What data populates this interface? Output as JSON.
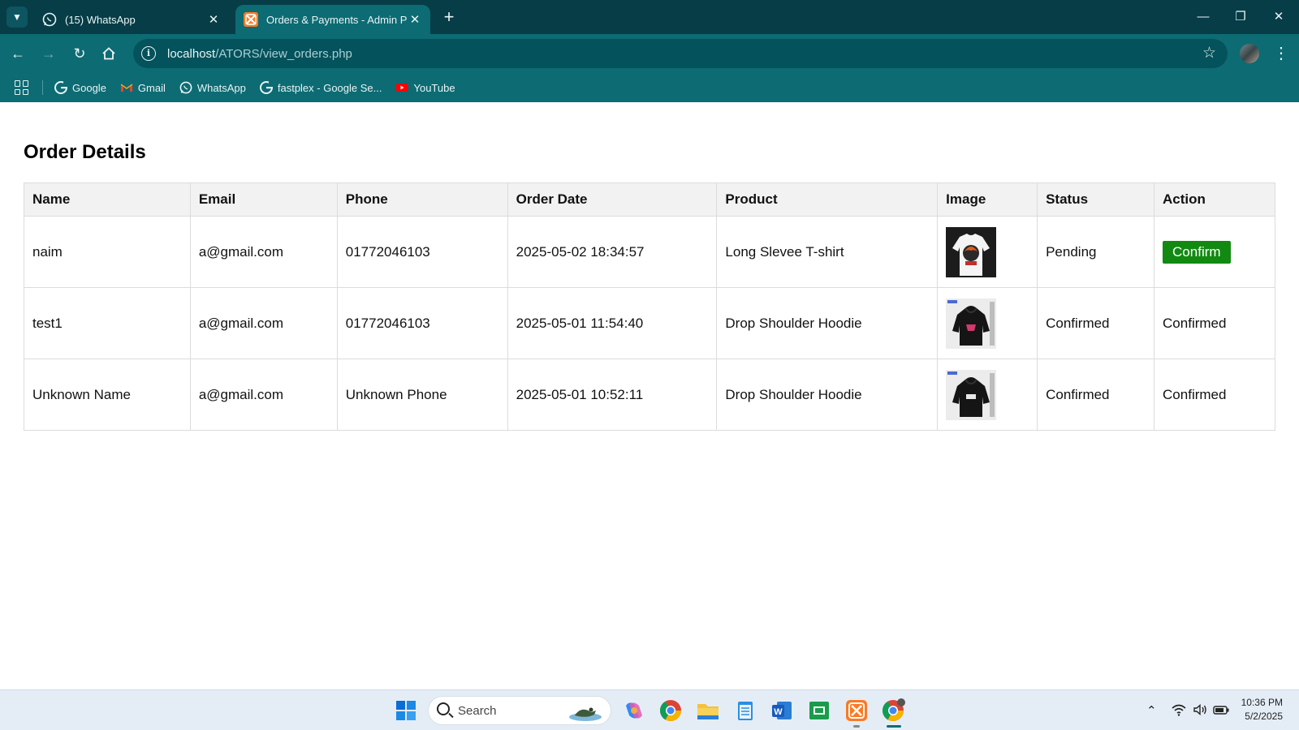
{
  "browser": {
    "tabs": [
      {
        "title": "(15) WhatsApp",
        "active": false,
        "favicon": "whatsapp-icon"
      },
      {
        "title": "Orders & Payments - Admin Pa",
        "active": true,
        "favicon": "xampp-icon"
      }
    ],
    "close_glyph": "✕",
    "new_tab_glyph": "+",
    "address": {
      "host": "localhost",
      "path": "/ATORS/view_orders.php"
    },
    "bookmarks": [
      {
        "label": "Google",
        "icon": "google-icon"
      },
      {
        "label": "Gmail",
        "icon": "gmail-icon"
      },
      {
        "label": "WhatsApp",
        "icon": "whatsapp-icon"
      },
      {
        "label": "fastplex - Google Se...",
        "icon": "google-icon"
      },
      {
        "label": "YouTube",
        "icon": "youtube-icon"
      }
    ],
    "accent_color": "#0d6b73"
  },
  "page": {
    "title": "Order Details",
    "table": {
      "headers": [
        "Name",
        "Email",
        "Phone",
        "Order Date",
        "Product",
        "Image",
        "Status",
        "Action"
      ],
      "rows": [
        {
          "name": "naim",
          "email": "a@gmail.com",
          "phone": "01772046103",
          "date": "2025-05-02 18:34:57",
          "product": "Long Slevee T-shirt",
          "image": "white-tshirt-thumbnail",
          "status": "Pending",
          "action": "Confirm",
          "action_is_button": true
        },
        {
          "name": "test1",
          "email": "a@gmail.com",
          "phone": "01772046103",
          "date": "2025-05-01 11:54:40",
          "product": "Drop Shoulder Hoodie",
          "image": "black-hoodie-thumbnail",
          "status": "Confirmed",
          "action": "Confirmed",
          "action_is_button": false
        },
        {
          "name": "Unknown Name",
          "email": "a@gmail.com",
          "phone": "Unknown Phone",
          "date": "2025-05-01 10:52:11",
          "product": "Drop Shoulder Hoodie",
          "image": "black-hoodie-thumbnail",
          "status": "Confirmed",
          "action": "Confirmed",
          "action_is_button": false
        }
      ]
    },
    "confirm_button_color": "#128a12"
  },
  "taskbar": {
    "search_placeholder": "Search",
    "time": "10:36 PM",
    "date": "5/2/2025"
  }
}
